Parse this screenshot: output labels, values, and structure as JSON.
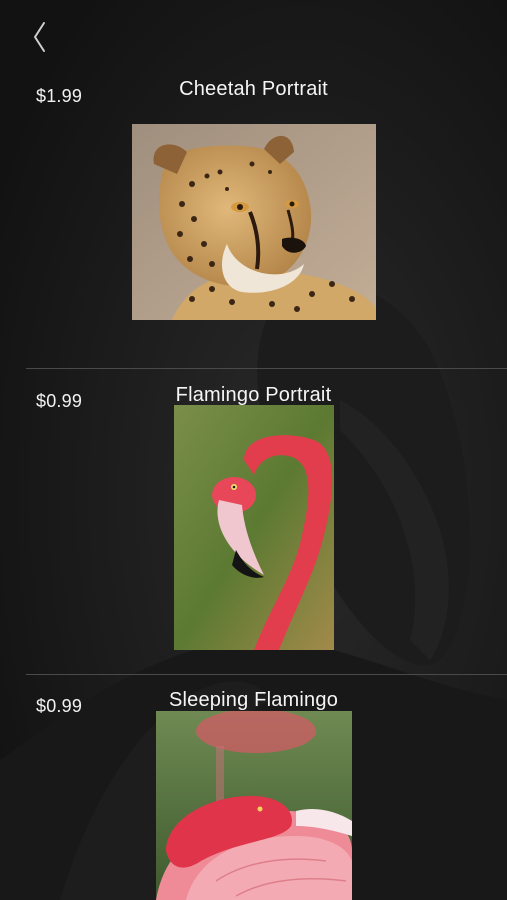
{
  "nav": {
    "back_icon": "chevron-left-icon"
  },
  "items": [
    {
      "price": "$1.99",
      "title": "Cheetah Portrait",
      "image": "cheetah-photo"
    },
    {
      "price": "$0.99",
      "title": "Flamingo Portrait",
      "image": "flamingo-portrait-photo"
    },
    {
      "price": "$0.99",
      "title": "Sleeping Flamingo",
      "image": "sleeping-flamingo-photo"
    }
  ],
  "colors": {
    "background": "#151515",
    "text": "#ffffff",
    "divider": "#4a4a4a"
  }
}
